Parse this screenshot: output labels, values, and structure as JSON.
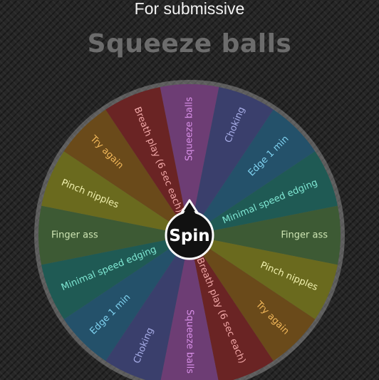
{
  "header": {
    "title": "For submissive",
    "result": "Squeeze balls"
  },
  "wheel": {
    "spin_label": "Spin",
    "segments": [
      {
        "label": "Squeeze balls",
        "color": "#6d3d74",
        "text_color": "#d78ee6"
      },
      {
        "label": "Choking",
        "color": "#3a3f6c",
        "text_color": "#a8aee8"
      },
      {
        "label": "Edge 1 min",
        "color": "#24516a",
        "text_color": "#7fd2f0"
      },
      {
        "label": "Minimal speed edging",
        "color": "#1f5a54",
        "text_color": "#7fe8d4"
      },
      {
        "label": "Finger ass",
        "color": "#3d5a34",
        "text_color": "#cfe6b4"
      },
      {
        "label": "Pinch nipples",
        "color": "#6a6a1e",
        "text_color": "#f2f2b0"
      },
      {
        "label": "Try again",
        "color": "#6a4a1a",
        "text_color": "#f2b85a"
      },
      {
        "label": "Breath play (6 sec each)",
        "color": "#6a2424",
        "text_color": "#f2a8a8"
      },
      {
        "label": "Squeeze balls",
        "color": "#6d3d74",
        "text_color": "#d78ee6"
      },
      {
        "label": "Choking",
        "color": "#3a3f6c",
        "text_color": "#a8aee8"
      },
      {
        "label": "Edge 1 min",
        "color": "#24516a",
        "text_color": "#7fd2f0"
      },
      {
        "label": "Minimal speed edging",
        "color": "#1f5a54",
        "text_color": "#7fe8d4"
      },
      {
        "label": "Finger ass",
        "color": "#3d5a34",
        "text_color": "#cfe6b4"
      },
      {
        "label": "Pinch nipples",
        "color": "#6a6a1e",
        "text_color": "#f2f2b0"
      },
      {
        "label": "Try again",
        "color": "#6a4a1a",
        "text_color": "#f2b85a"
      },
      {
        "label": "Breath play (6 sec each)",
        "color": "#6a2424",
        "text_color": "#f2a8a8"
      }
    ]
  }
}
